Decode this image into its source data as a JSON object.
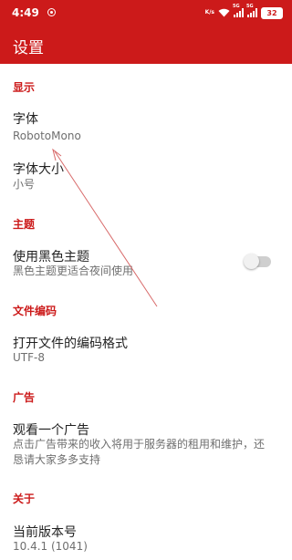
{
  "status_bar": {
    "time": "4:49",
    "net_speed_top": "K/s",
    "net_speed_bottom": "K/s",
    "sig1_tag": "5G",
    "sig2_tag": "5G",
    "battery": "32"
  },
  "toolbar": {
    "title": "设置"
  },
  "sections": {
    "display": {
      "header": "显示",
      "font": {
        "title": "字体",
        "summary": "RobotoMono"
      },
      "font_size": {
        "title": "字体大小",
        "summary": "小号"
      }
    },
    "theme": {
      "header": "主题",
      "dark_theme": {
        "title": "使用黑色主题",
        "summary": "黑色主题更适合夜间使用",
        "enabled": false
      }
    },
    "encoding": {
      "header": "文件编码",
      "open_encoding": {
        "title": "打开文件的编码格式",
        "summary": "UTF-8"
      }
    },
    "ads": {
      "header": "广告",
      "watch_ad": {
        "title": "观看一个广告",
        "summary": "点击广告带来的收入将用于服务器的租用和维护，还恳请大家多多支持"
      }
    },
    "about": {
      "header": "关于",
      "version": {
        "title": "当前版本号",
        "summary": "10.4.1 (1041)"
      }
    }
  },
  "colors": {
    "accent": "#cc1a1a",
    "annotation_arrow": "#d86a6a"
  }
}
